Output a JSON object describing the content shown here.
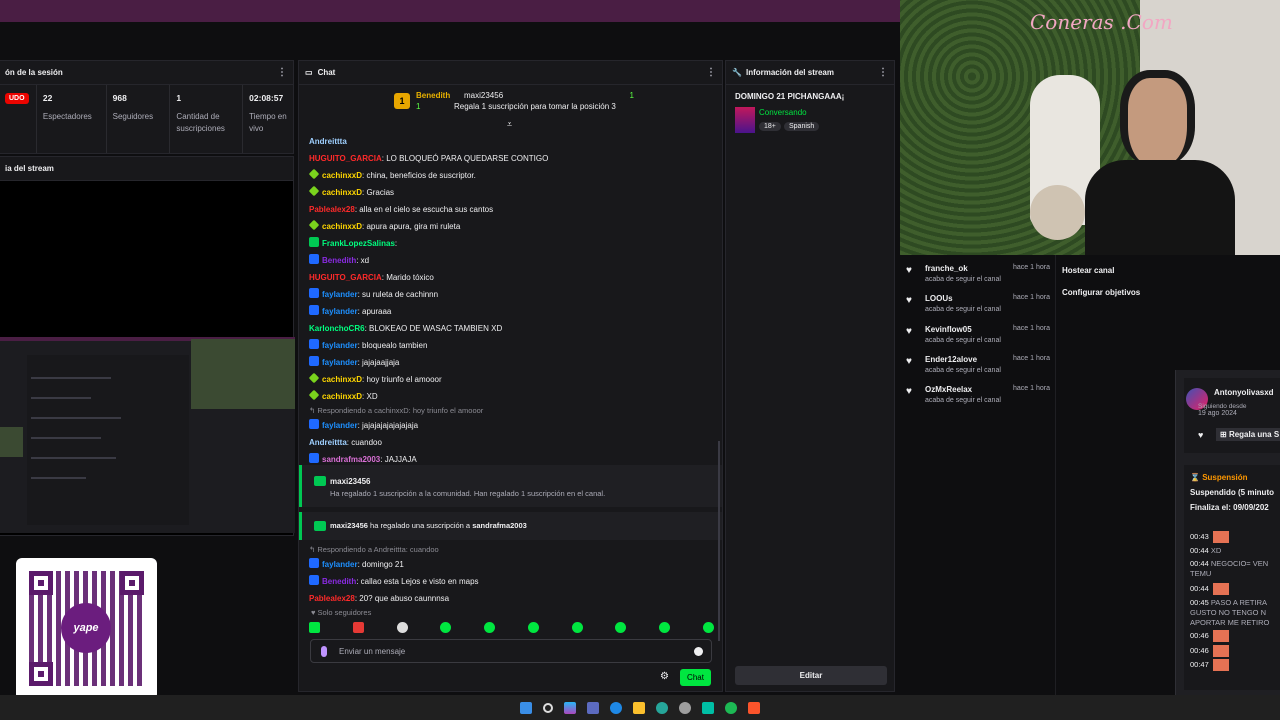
{
  "session": {
    "title": "ón de la sesión",
    "live": "UDO",
    "stats": [
      {
        "num": "22",
        "label": "Espectadores"
      },
      {
        "num": "968",
        "label": "Seguidores"
      },
      {
        "num": "1",
        "label": "Cantidad de suscripciones"
      },
      {
        "num": "02:08:57",
        "label": "Tiempo en vivo"
      }
    ]
  },
  "preview": {
    "title": "ia del stream"
  },
  "chat": {
    "title": "Chat",
    "pinned": {
      "rank": "1",
      "user1": "Benedith",
      "count1": "1",
      "user2": "maxi23456",
      "count2": "1",
      "message": "Regala 1 suscripción para tomar la posición 3"
    },
    "lines": [
      {
        "user": "Andreittta",
        "color": "#9fd0ff",
        "badge": "",
        "text": ""
      },
      {
        "user": "HUGUITO_GARCIA",
        "color": "#ff2a2a",
        "badge": "",
        "text": ": LO BLOQUEÓ PARA QUEDARSE CONTIGO"
      },
      {
        "user": "cachinxxD",
        "color": "#ffd700",
        "badge": "sub",
        "text": ": china, beneficios de suscriptor."
      },
      {
        "user": "cachinxxD",
        "color": "#ffd700",
        "badge": "sub",
        "text": ": Gracias"
      },
      {
        "user": "Pablealex28",
        "color": "#ff2a2a",
        "badge": "",
        "text": ": alla en el cielo se escucha sus cantos"
      },
      {
        "user": "cachinxxD",
        "color": "#ffd700",
        "badge": "sub",
        "text": ": apura apura, gira mi ruleta"
      },
      {
        "user": "FrankLopezSalinas",
        "color": "#00ff7f",
        "badge": "gift",
        "text": ":"
      },
      {
        "user": "Benedith",
        "color": "#8a2be2",
        "badge": "prime",
        "text": ": xd"
      },
      {
        "user": "HUGUITO_GARCIA",
        "color": "#ff2a2a",
        "badge": "",
        "text": ": Marido tóxico"
      },
      {
        "user": "faylander",
        "color": "#1e90ff",
        "badge": "prime",
        "text": ": su ruleta de cachinnn"
      },
      {
        "user": "faylander",
        "color": "#1e90ff",
        "badge": "prime",
        "text": ": apuraaa"
      },
      {
        "user": "KarlonchoCR6",
        "color": "#00ff7f",
        "badge": "",
        "text": ": BLOKEAO DE WASAC TAMBIEN XD"
      },
      {
        "user": "faylander",
        "color": "#1e90ff",
        "badge": "prime",
        "text": ": bloquealo tambien"
      },
      {
        "user": "faylander",
        "color": "#1e90ff",
        "badge": "prime",
        "text": ": jajajaajjaja"
      },
      {
        "user": "cachinxxD",
        "color": "#ffd700",
        "badge": "sub",
        "text": ": hoy triunfo el amooor"
      },
      {
        "user": "cachinxxD",
        "color": "#ffd700",
        "badge": "sub",
        "text": ": XD"
      }
    ],
    "reply1": "Respondiendo a cachinxxD: hoy triunfo el amooor",
    "lines2": [
      {
        "user": "faylander",
        "color": "#1e90ff",
        "badge": "prime",
        "text": ": jajajajajajajajaja"
      },
      {
        "user": "Andreittta",
        "color": "#9fd0ff",
        "badge": "",
        "text": ": cuandoo"
      },
      {
        "user": "sandrafma2003",
        "color": "#da70d6",
        "badge": "prime",
        "text": ": JAJJAJA"
      }
    ],
    "notice1": {
      "user": "maxi23456",
      "text": "Ha regalado 1 suscripción a la comunidad. Han regalado 1 suscripción en el canal."
    },
    "notice2": {
      "user": "maxi23456",
      "middle": " ha regalado una suscripción a ",
      "target": "sandrafma2003"
    },
    "reply2": "Respondiendo a Andreittta: cuandoo",
    "lines3": [
      {
        "user": "faylander",
        "color": "#1e90ff",
        "badge": "prime",
        "text": ": domingo 21"
      },
      {
        "user": "Benedith",
        "color": "#8a2be2",
        "badge": "prime",
        "text": ": callao esta Lejos e visto en maps"
      },
      {
        "user": "Pablealex28",
        "color": "#ff2a2a",
        "badge": "",
        "text": ": 20? que abuso caunnnsa"
      }
    ],
    "followers_only": "Solo seguidores",
    "input_placeholder": "Enviar un mensaje",
    "send_label": "Chat"
  },
  "info": {
    "title": "Información del stream",
    "stream_title": "DOMINGO 21 PICHANGAAA¡",
    "category": "Conversando",
    "tags": [
      "18+",
      "Spanish"
    ],
    "edit_label": "Editar"
  },
  "webcam": {
    "sign": "Coneras .Com"
  },
  "follows": [
    {
      "name": "franche_ok",
      "time": "hace 1 hora",
      "sub": "acaba de seguir el canal"
    },
    {
      "name": "LOOUs",
      "time": "hace 1 hora",
      "sub": "acaba de seguir el canal"
    },
    {
      "name": "Kevinflow05",
      "time": "hace 1 hora",
      "sub": "acaba de seguir el canal"
    },
    {
      "name": "Ender12alove",
      "time": "hace 1 hora",
      "sub": "acaba de seguir el canal"
    },
    {
      "name": "OzMxReelax",
      "time": "hace 1 hora",
      "sub": "acaba de seguir el canal"
    }
  ],
  "actions": [
    "Hostear canal",
    "Configurar objetivos"
  ],
  "card": {
    "user": "Antonyolivasxd",
    "since_label": "Siguiendo desde",
    "since_date": "19 ago 2024",
    "gift_label": "Regala una S",
    "suspension": "Suspensión",
    "suspended": "Suspendido (5 minuto",
    "ends": "Finaliza el: 09/09/202",
    "log": [
      {
        "t": "00:43",
        "m": ""
      },
      {
        "t": "00:44",
        "m": "XD"
      },
      {
        "t": "00:44",
        "m": "NEGOCIO= VEN"
      },
      {
        "t": "",
        "m": "TEMU"
      },
      {
        "t": "00:44",
        "m": ""
      },
      {
        "t": "00:45",
        "m": "PASO A RETIRA"
      },
      {
        "t": "",
        "m": "GUSTO NO TENGO N"
      },
      {
        "t": "",
        "m": "APORTAR ME RETIRO"
      },
      {
        "t": "00:46",
        "m": ""
      },
      {
        "t": "00:46",
        "m": ""
      },
      {
        "t": "00:47",
        "m": ""
      }
    ]
  },
  "qr": {
    "logo": "yape"
  }
}
